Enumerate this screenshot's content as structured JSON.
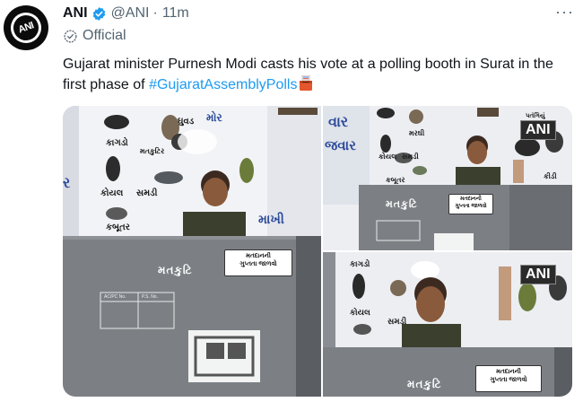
{
  "account": {
    "avatar_text": "ANI",
    "name": "ANI",
    "handle": "@ANI",
    "separator": "·",
    "time": "11m",
    "official_label": "Official",
    "verified_color": "#1d9bf0"
  },
  "tweet": {
    "text": "Gujarat minister Purnesh Modi casts his vote at a polling booth in Surat in the first phase of",
    "hashtag": "#GujaratAssemblyPolls",
    "emoji_icon": "ballot-box-icon"
  },
  "media": {
    "photo1": {
      "birds": [
        "ઘુવડ",
        "મોર",
        "કાગડો",
        "મતકુટિર",
        "કોયલ",
        "સમડી",
        "કબૂતર"
      ],
      "wall_words": [
        "ર",
        "માખી"
      ],
      "booth_label": "મતકુટિ",
      "sticker_line1": "મતદાનની",
      "sticker_line2": "ગુપ્તતા જાળવો",
      "form_field_1": "AC/PC No.",
      "form_field_2": "P.S. No."
    },
    "photo2": {
      "wall_words": [
        "વાર",
        "જવાર"
      ],
      "birds": [
        "પતંગિયું",
        "મરઘી",
        "કોયલ",
        "સમડી",
        "કબૂતર",
        "કીડી"
      ],
      "booth_label": "મતકુટિ",
      "sticker_line1": "મતદાનની",
      "sticker_line2": "ગુપ્તતા જાળવો",
      "watermark": "ANI"
    },
    "photo3": {
      "birds": [
        "કાગડો",
        "કોયલ",
        "સમડી"
      ],
      "booth_label": "મતકુટિ",
      "sticker_line1": "મતદાનની",
      "sticker_line2": "ગુપ્તતા જાળવો",
      "watermark": "ANI"
    }
  }
}
